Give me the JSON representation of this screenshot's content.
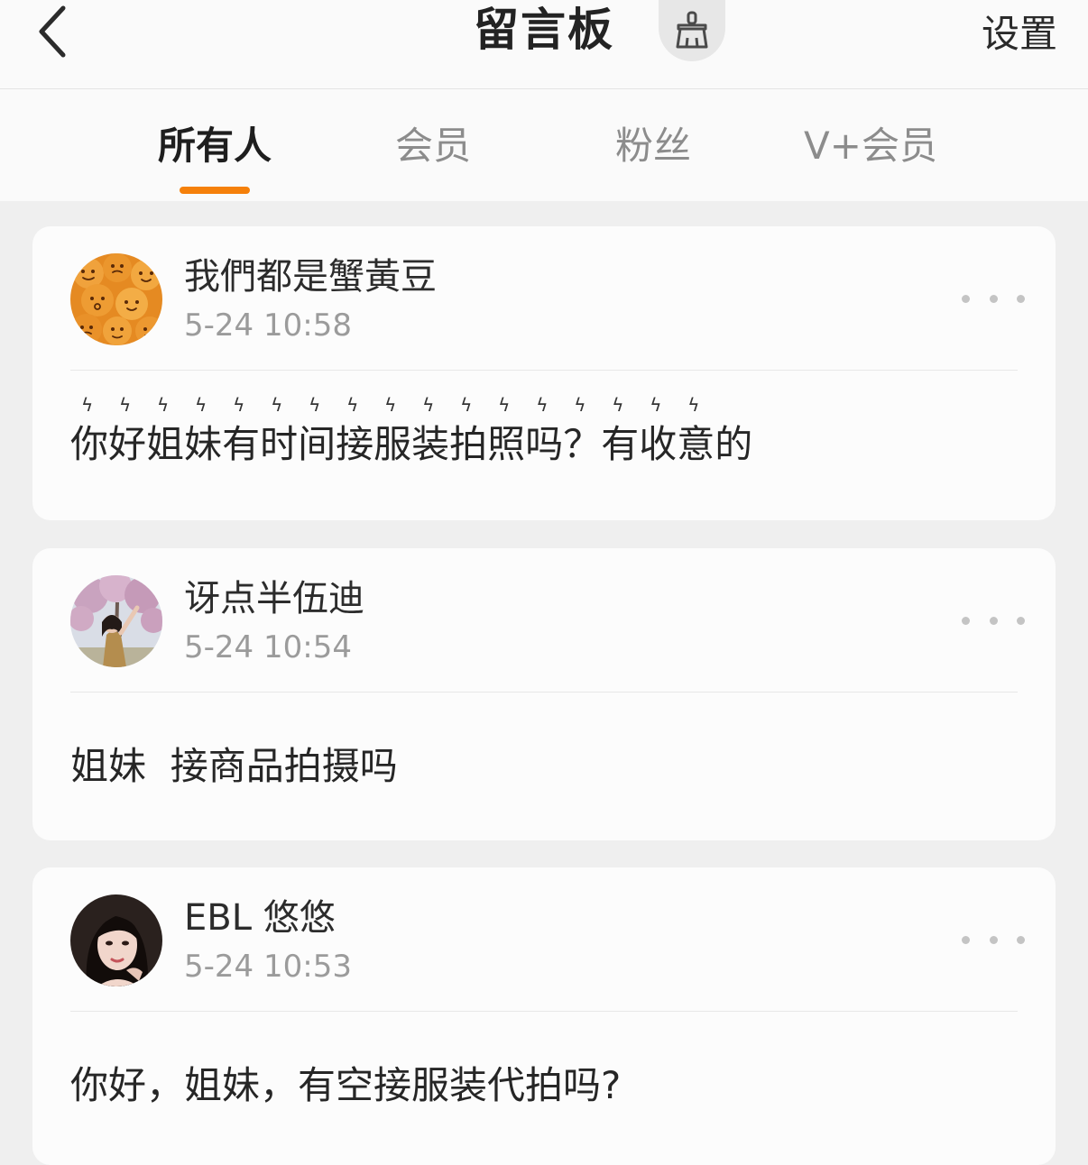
{
  "header": {
    "back_icon": "chevron-left-icon",
    "title": "留言板",
    "clean_icon": "broom-icon",
    "settings_label": "设置"
  },
  "tabs": [
    {
      "label": "所有人",
      "active": true
    },
    {
      "label": "会员",
      "active": false
    },
    {
      "label": "粉丝",
      "active": false
    },
    {
      "label": "V+会员",
      "active": false
    }
  ],
  "colors": {
    "accent": "#f5800a",
    "background": "#efefef",
    "card": "#fcfcfc",
    "secondary_text": "#9b9b9b"
  },
  "messages": [
    {
      "username": "我們都是蟹黃豆",
      "time": "5-24 10:58",
      "avatar_icon": "emoji-cookies-avatar",
      "text_spark": "你好姐妹有时间接服装拍照吗？有收意",
      "text_plain": "的",
      "more_icon": "more-dots-icon"
    },
    {
      "username": "讶点半伍迪",
      "time": "5-24 10:54",
      "avatar_icon": "girl-under-blossom-tree-avatar",
      "text": "姐妹  接商品拍摄吗",
      "more_icon": "more-dots-icon"
    },
    {
      "username": "EBL 悠悠",
      "time": "5-24 10:53",
      "avatar_icon": "girl-portrait-avatar",
      "text": "你好，姐妹，有空接服装代拍吗?",
      "more_icon": "more-dots-icon"
    }
  ]
}
